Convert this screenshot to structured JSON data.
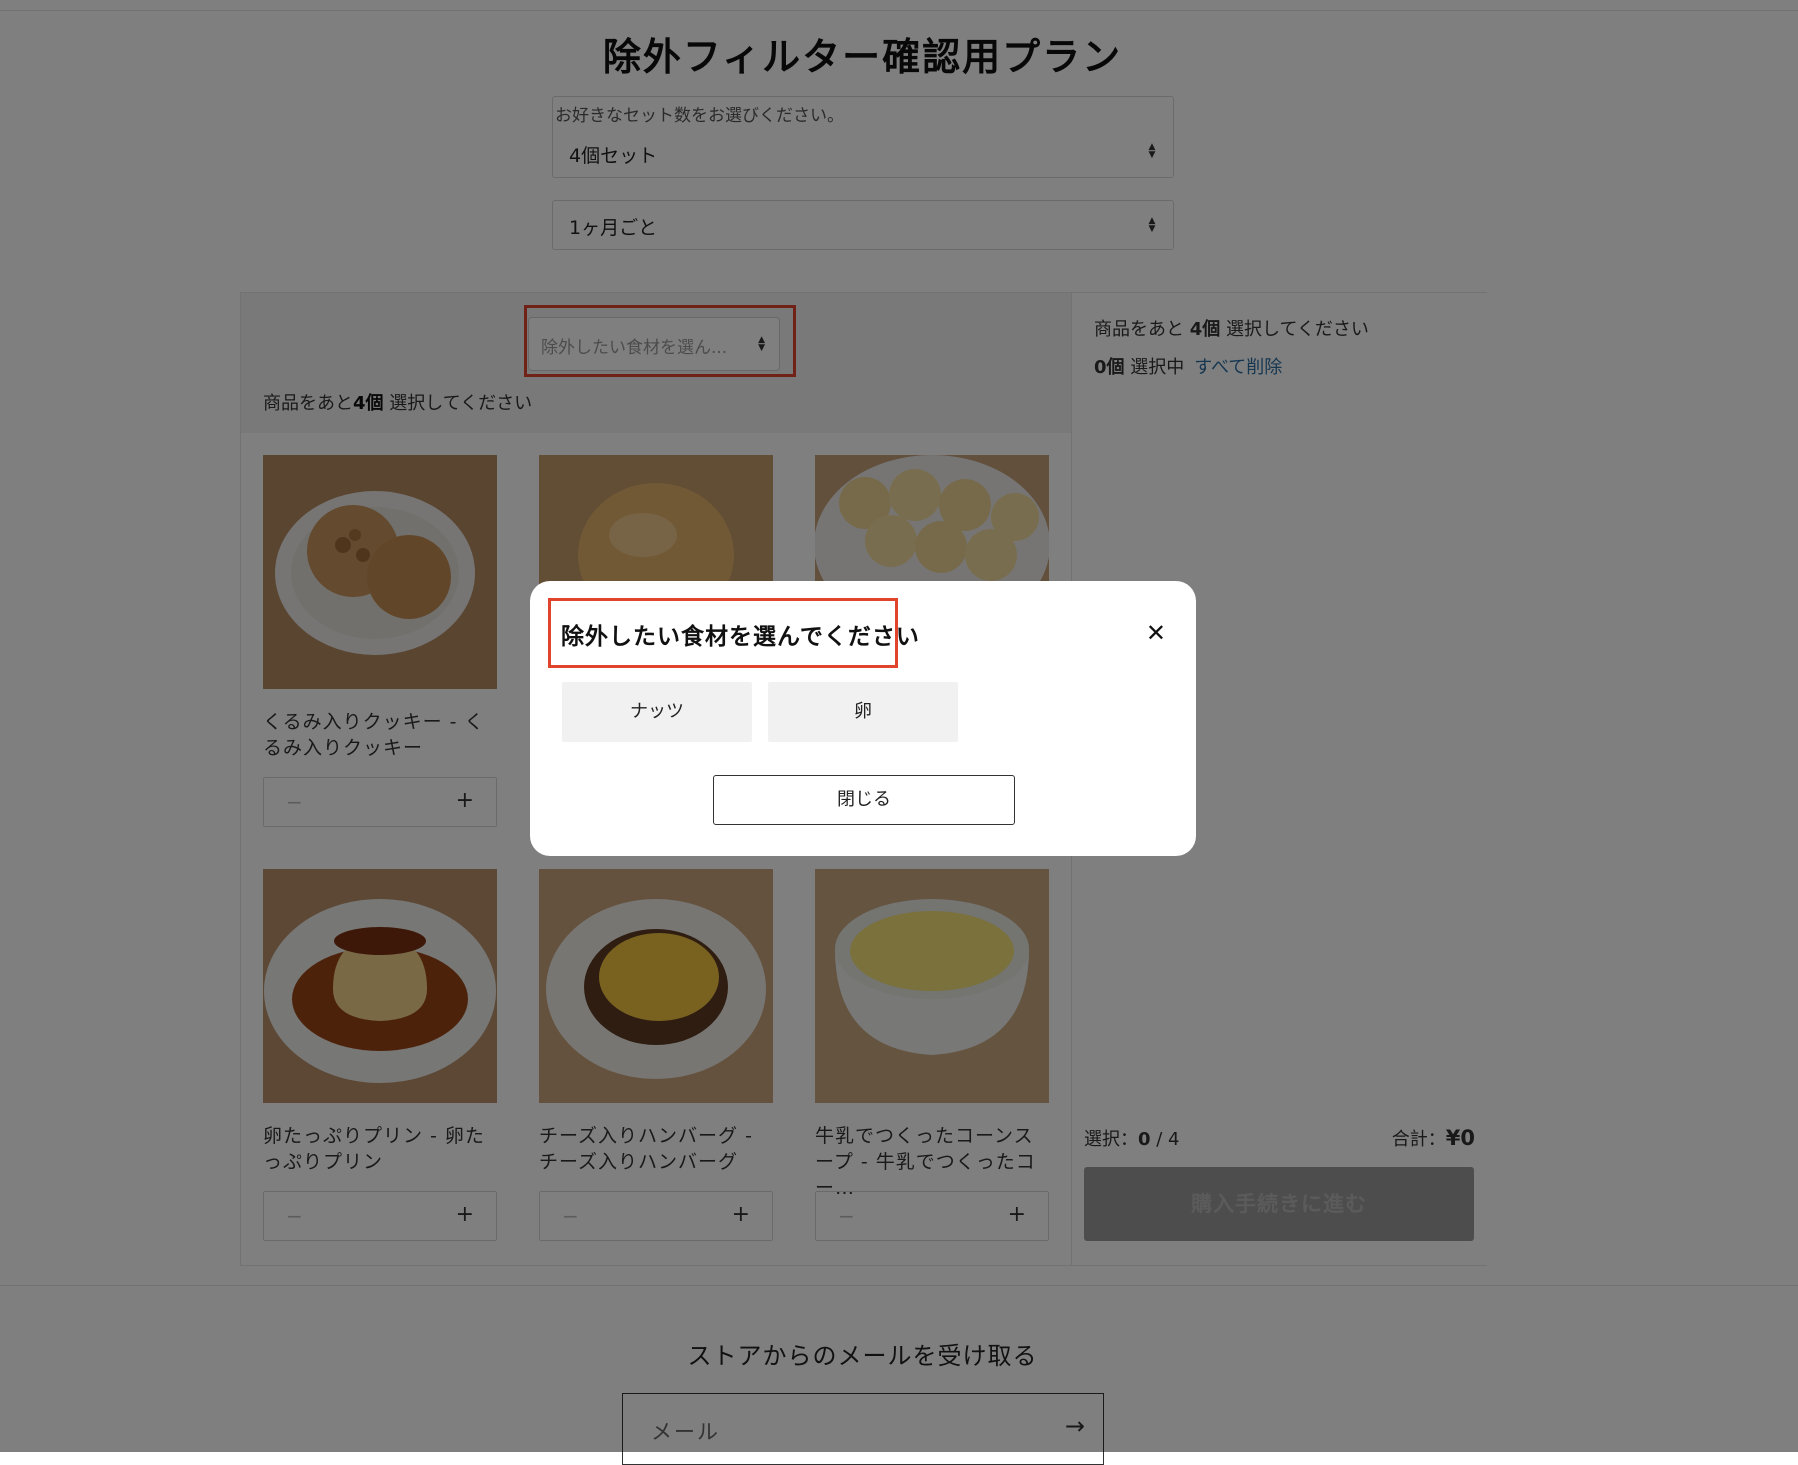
{
  "page_title": "除外フィルター確認用プラン",
  "set_select": {
    "label": "お好きなセット数をお選びください。",
    "value": "4個セット"
  },
  "frequency_select": {
    "value": "1ヶ月ごと"
  },
  "filter": {
    "placeholder": "除外したい食材を選ん...",
    "remaining_prefix": "商品をあと",
    "remaining_count": "4個",
    "remaining_suffix": " 選択してください"
  },
  "products": [
    {
      "name": "くるみ入りクッキー - くるみ入りクッキー",
      "minus": "−",
      "plus": "+"
    },
    {
      "name": "",
      "minus": "−",
      "plus": "+"
    },
    {
      "name": "",
      "minus": "−",
      "plus": "+"
    },
    {
      "name": "卵たっぷりプリン - 卵たっぷりプリン",
      "minus": "−",
      "plus": "+"
    },
    {
      "name": "チーズ入りハンバーグ - チーズ入りハンバーグ",
      "minus": "−",
      "plus": "+"
    },
    {
      "name": "牛乳でつくったコーンスープ - 牛乳でつくったコー…",
      "minus": "−",
      "plus": "+"
    }
  ],
  "summary": {
    "remaining_prefix": "商品をあと ",
    "remaining_count": "4個",
    "remaining_suffix": " 選択してください",
    "selected_count": "0個",
    "selected_suffix": " 選択中",
    "clear_all": "すべて削除",
    "selection_label": "選択：",
    "selection_value": "0",
    "selection_total": " / 4",
    "total_label": "合計：",
    "total_value": "¥0",
    "checkout": "購入手続きに進む"
  },
  "newsletter": {
    "title": "ストアからのメールを受け取る",
    "email_placeholder": "メール",
    "arrow": "→"
  },
  "modal": {
    "title": "除外したい食材を選んでください",
    "close_icon": "✕",
    "options": [
      "ナッツ",
      "卵"
    ],
    "close_button": "閉じる"
  },
  "colors": {
    "highlight": "#e0452c",
    "link": "#2f6fa3",
    "checkout_disabled": "#9a9a9a"
  }
}
